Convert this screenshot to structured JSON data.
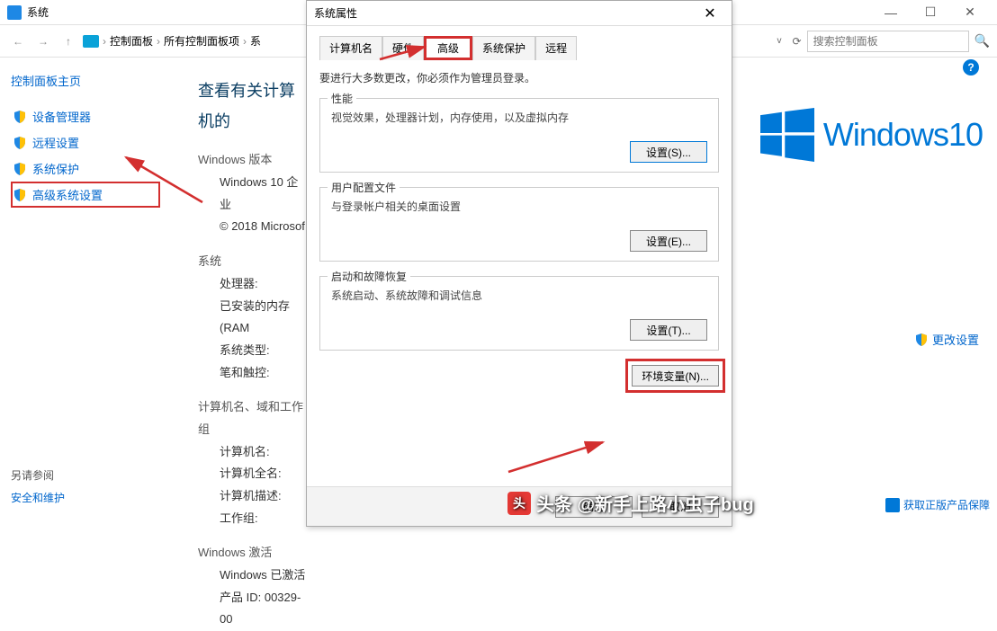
{
  "titlebar": {
    "title": "系统"
  },
  "breadcrumb": {
    "part1": "控制面板",
    "part2": "所有控制面板项",
    "part3": "系"
  },
  "search": {
    "placeholder": "搜索控制面板"
  },
  "sidebar": {
    "title": "控制面板主页",
    "items": [
      {
        "label": "设备管理器"
      },
      {
        "label": "远程设置"
      },
      {
        "label": "系统保护"
      },
      {
        "label": "高级系统设置"
      }
    ],
    "bottom_heading": "另请参阅",
    "bottom_link": "安全和维护"
  },
  "mid": {
    "heading": "查看有关计算机的",
    "win_edition": "Windows 版本",
    "win_version": "Windows 10 企业",
    "copyright": "© 2018 Microsof",
    "system": "系统",
    "processor": "处理器:",
    "ram": "已安装的内存(RAM",
    "systype": "系统类型:",
    "pen": "笔和触控:",
    "compname_section": "计算机名、域和工作组",
    "compname": "计算机名:",
    "fullname": "计算机全名:",
    "compdesc": "计算机描述:",
    "workgroup": "工作组:",
    "activation": "Windows 激活",
    "activated": "Windows 已激活",
    "productid": "产品 ID: 00329-00"
  },
  "dialog": {
    "title": "系统属性",
    "tabs": [
      "计算机名",
      "硬件",
      "高级",
      "系统保护",
      "远程"
    ],
    "note": "要进行大多数更改，你必须作为管理员登录。",
    "perf": {
      "title": "性能",
      "text": "视觉效果，处理器计划，内存使用，以及虚拟内存",
      "btn": "设置(S)..."
    },
    "profile": {
      "title": "用户配置文件",
      "text": "与登录帐户相关的桌面设置",
      "btn": "设置(E)..."
    },
    "startup": {
      "title": "启动和故障恢复",
      "text": "系统启动、系统故障和调试信息",
      "btn": "设置(T)..."
    },
    "env_btn": "环境变量(N)...",
    "ok": "确定",
    "cancel": "取消"
  },
  "right": {
    "win10": "Windows10",
    "change_settings": "更改设置",
    "genuine": "获取正版产品保障"
  },
  "watermark": "头条 @新手上路小虫子bug"
}
